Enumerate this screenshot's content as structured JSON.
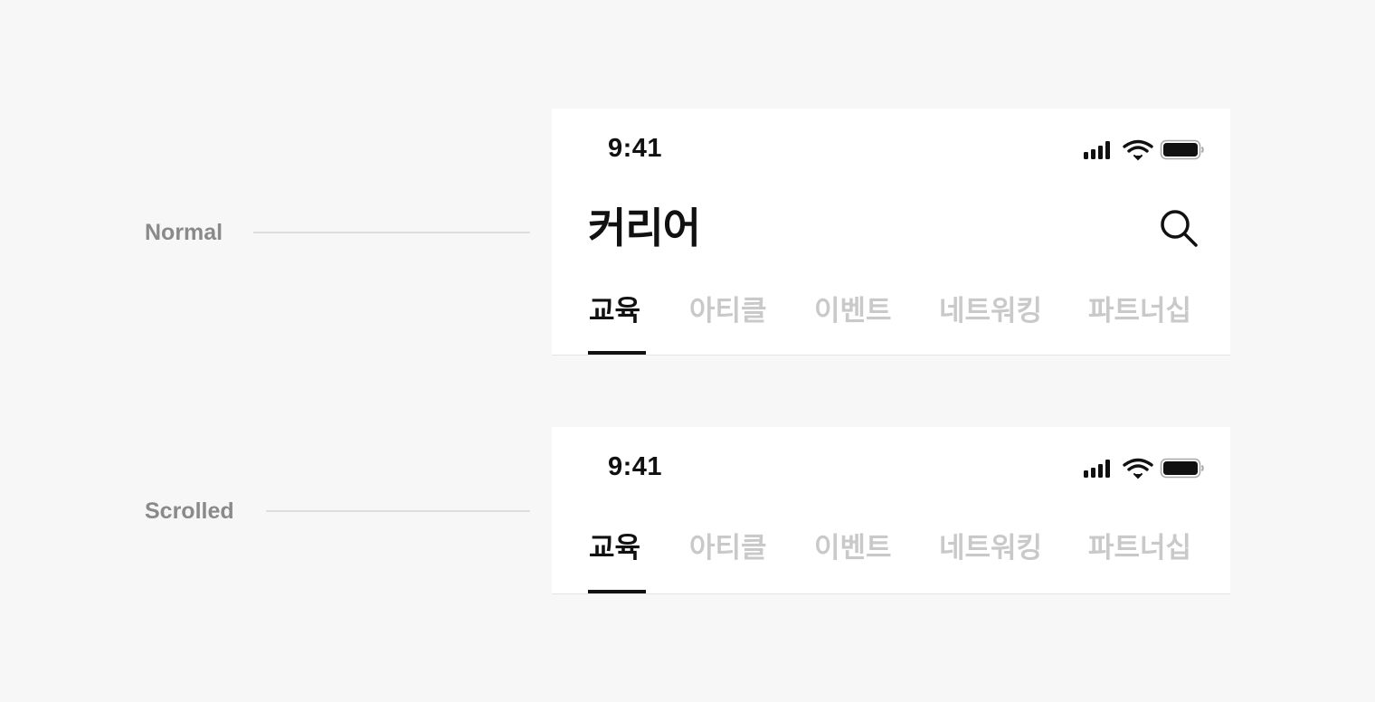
{
  "labels": {
    "normal": "Normal",
    "scrolled": "Scrolled"
  },
  "status_bar": {
    "time": "9:41",
    "icons": [
      "cellular-signal-icon",
      "wifi-icon",
      "battery-icon"
    ]
  },
  "header": {
    "title": "커리어",
    "search_icon": "search-icon"
  },
  "tabs": [
    {
      "label": "교육",
      "active": true
    },
    {
      "label": "아티클",
      "active": false
    },
    {
      "label": "이벤트",
      "active": false
    },
    {
      "label": "네트워킹",
      "active": false
    },
    {
      "label": "파트너십",
      "active": false
    }
  ],
  "colors": {
    "background": "#f7f7f7",
    "surface": "#ffffff",
    "text_primary": "#111111",
    "text_inactive": "#c9c9c9",
    "label_gray": "#8a8a8a"
  }
}
